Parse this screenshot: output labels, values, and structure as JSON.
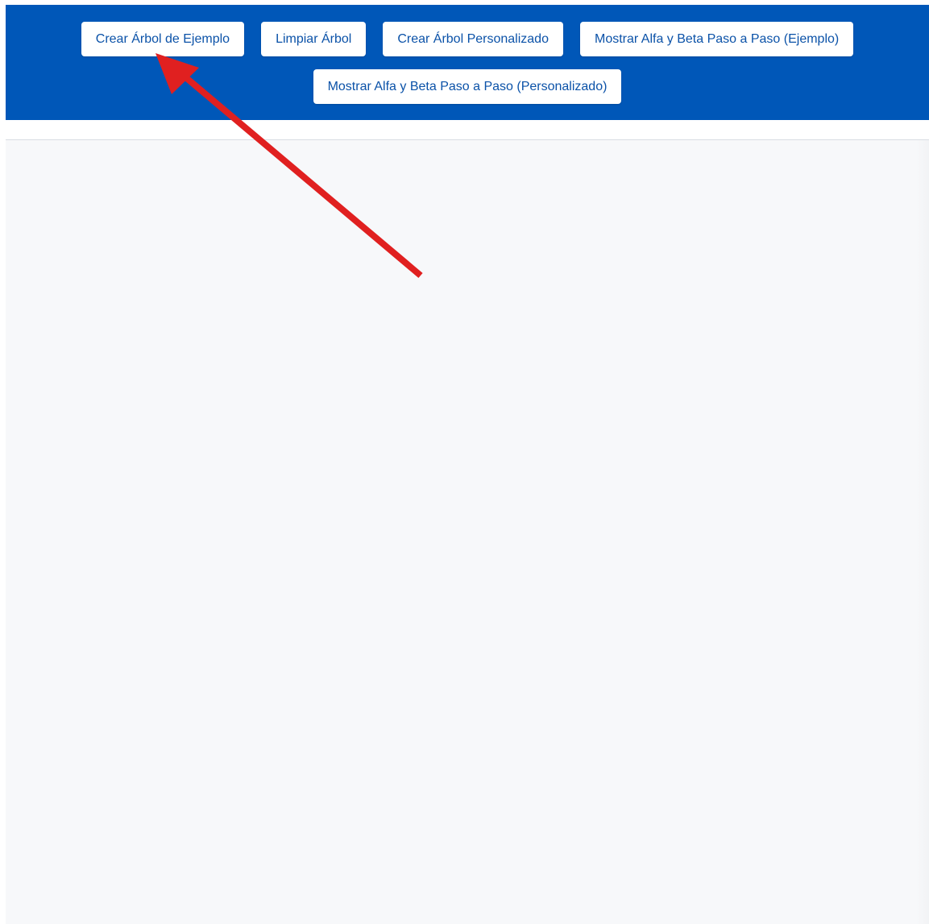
{
  "toolbar": {
    "buttons_row1": [
      "Crear Árbol de Ejemplo",
      "Limpiar Árbol",
      "Crear Árbol Personalizado",
      "Mostrar Alfa y Beta Paso a Paso (Ejemplo)"
    ],
    "buttons_row2": [
      "Mostrar Alfa y Beta Paso a Paso (Personalizado)"
    ],
    "background_color": "#0057b8",
    "button_text_color": "#0b52a8"
  },
  "annotation": {
    "arrow_color": "#e02020",
    "target": "Crear Árbol de Ejemplo"
  },
  "canvas": {
    "background_color": "#f7f8fa"
  }
}
